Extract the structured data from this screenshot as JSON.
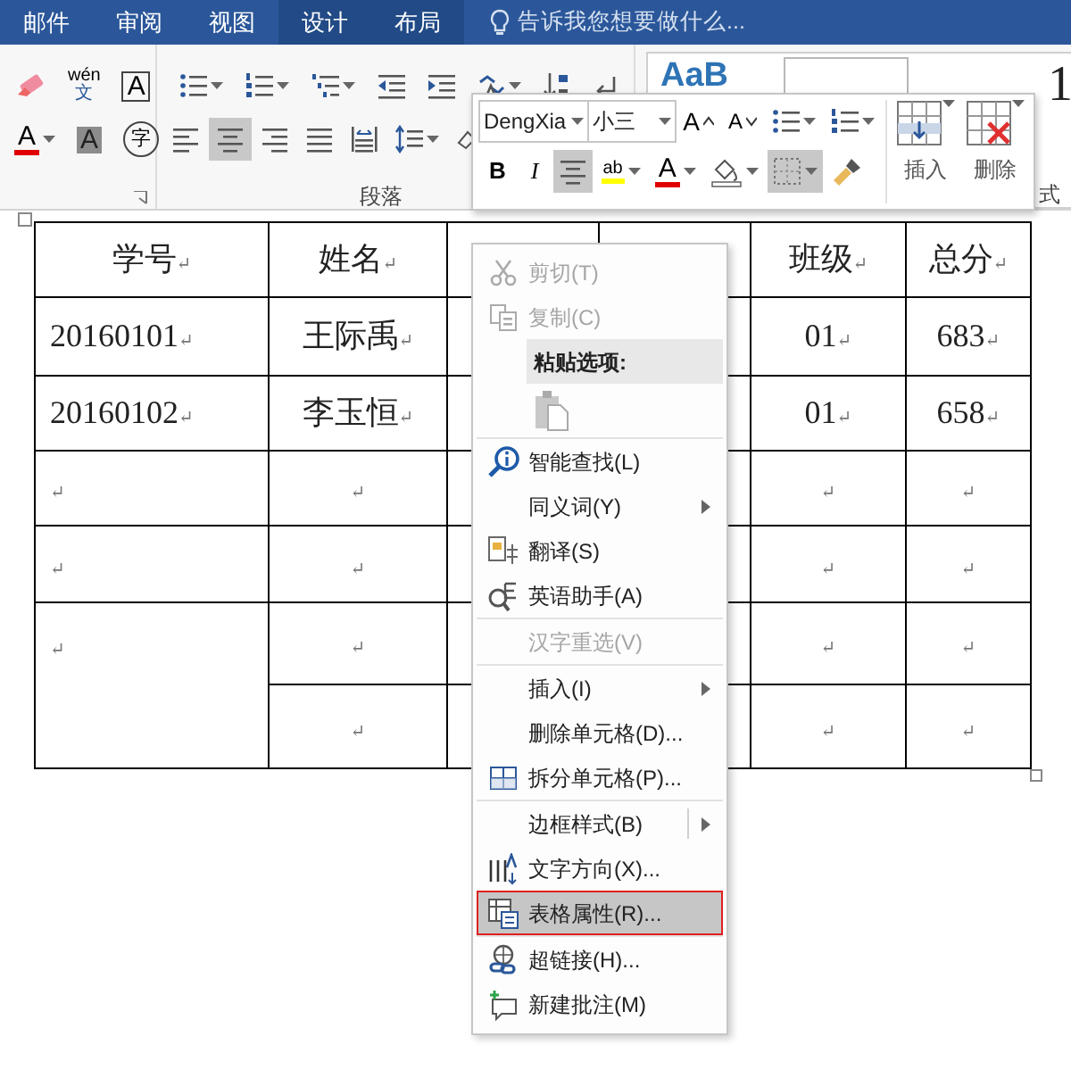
{
  "ribbon": {
    "tabs": [
      {
        "label": "邮件",
        "contextual": false
      },
      {
        "label": "审阅",
        "contextual": false
      },
      {
        "label": "视图",
        "contextual": false
      },
      {
        "label": "设计",
        "contextual": true
      },
      {
        "label": "布局",
        "contextual": true
      }
    ],
    "tell_me": "告诉我您想要做什么...",
    "font_group": {
      "row1": [
        {
          "dropdown": false,
          "selected": false
        },
        {
          "glyph": "wén",
          "sub": "文",
          "dropdown": false,
          "selected": false
        },
        {
          "glyph": "A",
          "dropdown": false,
          "selected": false
        }
      ],
      "row2": [
        {
          "glyph": "A",
          "dropdown": true,
          "selected": false
        },
        {
          "glyph": "A",
          "dropdown": false,
          "selected": false
        },
        {
          "glyph": "字",
          "dropdown": false,
          "selected": false
        }
      ]
    },
    "paragraph_group": {
      "label": "段落",
      "row1": [
        {
          "dropdown": true,
          "selected": false
        },
        {
          "dropdown": true,
          "selected": false
        },
        {
          "dropdown": true,
          "selected": false
        },
        {
          "dropdown": false,
          "selected": false
        },
        {
          "dropdown": false,
          "selected": false
        },
        {
          "dropdown": true,
          "selected": false
        },
        {
          "dropdown": false,
          "selected": false
        },
        {
          "dropdown": false,
          "selected": false
        }
      ],
      "row2": [
        {
          "dropdown": false,
          "selected": false
        },
        {
          "dropdown": false,
          "selected": true
        },
        {
          "dropdown": false,
          "selected": false
        },
        {
          "dropdown": false,
          "selected": false
        },
        {
          "dropdown": false,
          "selected": false
        },
        {
          "dropdown": true,
          "selected": false
        },
        {
          "dropdown": false,
          "selected": false
        }
      ]
    },
    "styles_group": {
      "tiles": [
        {
          "preview": "AaB",
          "selected": false
        },
        {
          "selected": true
        },
        {
          "selected": false
        }
      ],
      "preview_end": "1",
      "label": "式"
    }
  },
  "mini_toolbar": {
    "font": "DengXia",
    "size": "小三",
    "row1": [
      {
        "glyph": "A",
        "dropdown": false,
        "selected": false
      },
      {
        "glyph": "A",
        "dropdown": false,
        "selected": false
      },
      {
        "dropdown": true,
        "selected": false
      },
      {
        "dropdown": true,
        "selected": false
      }
    ],
    "row2": [
      {
        "glyph": "B",
        "dropdown": false,
        "selected": false
      },
      {
        "glyph": "I",
        "dropdown": false,
        "selected": false
      },
      {
        "dropdown": false,
        "selected": true
      },
      {
        "glyph": "ab",
        "dropdown": true,
        "selected": false
      },
      {
        "glyph": "A",
        "dropdown": true,
        "selected": false
      },
      {
        "dropdown": true,
        "selected": false
      },
      {
        "dropdown": true,
        "selected": true
      },
      {
        "dropdown": false,
        "selected": false
      }
    ],
    "insert": "插入",
    "delete": "删除"
  },
  "table": {
    "rows": [
      [
        {
          "text": "学号",
          "mark": "↵"
        },
        {
          "text": "姓名",
          "mark": "↵"
        },
        {},
        {},
        {
          "text": "班级",
          "mark": "↵"
        },
        {
          "text": "总分",
          "mark": "↵"
        }
      ],
      [
        {
          "text": "20160101",
          "mark": "↵"
        },
        {
          "text": "王际禹",
          "mark": "↵"
        },
        {},
        {},
        {
          "text": "01",
          "mark": "↵"
        },
        {
          "text": "683",
          "mark": "↵"
        }
      ],
      [
        {
          "text": "20160102",
          "mark": "↵"
        },
        {
          "text": "李玉恒",
          "mark": "↵"
        },
        {},
        {},
        {
          "text": "01",
          "mark": "↵"
        },
        {
          "text": "658",
          "mark": "↵"
        }
      ],
      [
        {
          "mark": "↵"
        },
        {
          "mark": "↵"
        },
        {},
        {},
        {
          "mark": "↵"
        },
        {
          "mark": "↵"
        }
      ],
      [
        {
          "mark": "↵"
        },
        {
          "mark": "↵"
        },
        {},
        {},
        {
          "mark": "↵"
        },
        {
          "mark": "↵"
        }
      ],
      [
        {
          "mark": "↵",
          "rowspan": 2
        },
        {
          "mark": "↵"
        },
        {},
        {},
        {
          "mark": "↵"
        },
        {
          "mark": "↵"
        }
      ],
      [
        {
          "mark": "↵"
        },
        {},
        {},
        {
          "mark": "↵"
        },
        {
          "mark": "↵"
        }
      ]
    ]
  },
  "context_menu": {
    "groups": [
      [
        {
          "label": "剪切(T)",
          "disabled": true,
          "submenu": false,
          "selected": false
        },
        {
          "label": "复制(C)",
          "disabled": true,
          "submenu": false,
          "selected": false
        },
        {
          "kind": "header",
          "label": "粘贴选项:"
        },
        {
          "kind": "paste-option"
        }
      ],
      [
        {
          "label": "智能查找(L)",
          "disabled": false,
          "submenu": false,
          "selected": false
        },
        {
          "label": "同义词(Y)",
          "disabled": false,
          "submenu": true,
          "selected": false
        },
        {
          "label": "翻译(S)",
          "disabled": false,
          "submenu": false,
          "selected": false
        },
        {
          "label": "英语助手(A)",
          "disabled": false,
          "submenu": false,
          "selected": false
        }
      ],
      [
        {
          "label": "汉字重选(V)",
          "disabled": true,
          "submenu": false,
          "selected": false
        }
      ],
      [
        {
          "label": "插入(I)",
          "disabled": false,
          "submenu": true,
          "selected": false
        },
        {
          "label": "删除单元格(D)...",
          "disabled": false,
          "submenu": false,
          "selected": false
        },
        {
          "label": "拆分单元格(P)...",
          "disabled": false,
          "submenu": false,
          "selected": false
        }
      ],
      [
        {
          "label": "边框样式(B)",
          "disabled": false,
          "submenu": true,
          "split": true,
          "selected": false
        },
        {
          "label": "文字方向(X)...",
          "disabled": false,
          "submenu": false,
          "selected": false
        },
        {
          "label": "表格属性(R)...",
          "disabled": false,
          "submenu": false,
          "selected": true
        }
      ],
      [
        {
          "label": "超链接(H)...",
          "disabled": false,
          "submenu": false,
          "selected": false
        },
        {
          "label": "新建批注(M)",
          "disabled": false,
          "submenu": false,
          "selected": false
        }
      ]
    ]
  }
}
